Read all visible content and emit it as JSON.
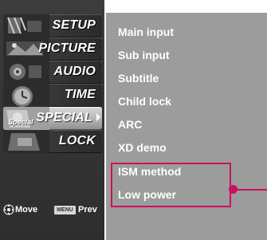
{
  "main_menu": {
    "items": [
      {
        "label": "SETUP",
        "icon": "setup-icon"
      },
      {
        "label": "PICTURE",
        "icon": "picture-icon"
      },
      {
        "label": "AUDIO",
        "icon": "audio-icon"
      },
      {
        "label": "TIME",
        "icon": "time-icon"
      },
      {
        "label": "SPECIAL",
        "icon": "special-icon",
        "selected": true
      },
      {
        "label": "LOCK",
        "icon": "lock-icon"
      }
    ],
    "special_thumb_text": "Special"
  },
  "bottom_bar": {
    "move_label": "Move",
    "menu_key_label": "MENU",
    "prev_label": "Prev"
  },
  "submenu": {
    "items": [
      {
        "label": "Main input"
      },
      {
        "label": "Sub input"
      },
      {
        "label": "Subtitle"
      },
      {
        "label": "Child lock"
      },
      {
        "label": "ARC"
      },
      {
        "label": "XD demo"
      },
      {
        "label": "ISM method",
        "highlighted": true
      },
      {
        "label": "Low power",
        "highlighted": true
      }
    ]
  },
  "colors": {
    "panel_bg": "#9c9c9c",
    "left_bg": "#353535",
    "highlight": "#cc1060",
    "text": "#ffffff"
  }
}
